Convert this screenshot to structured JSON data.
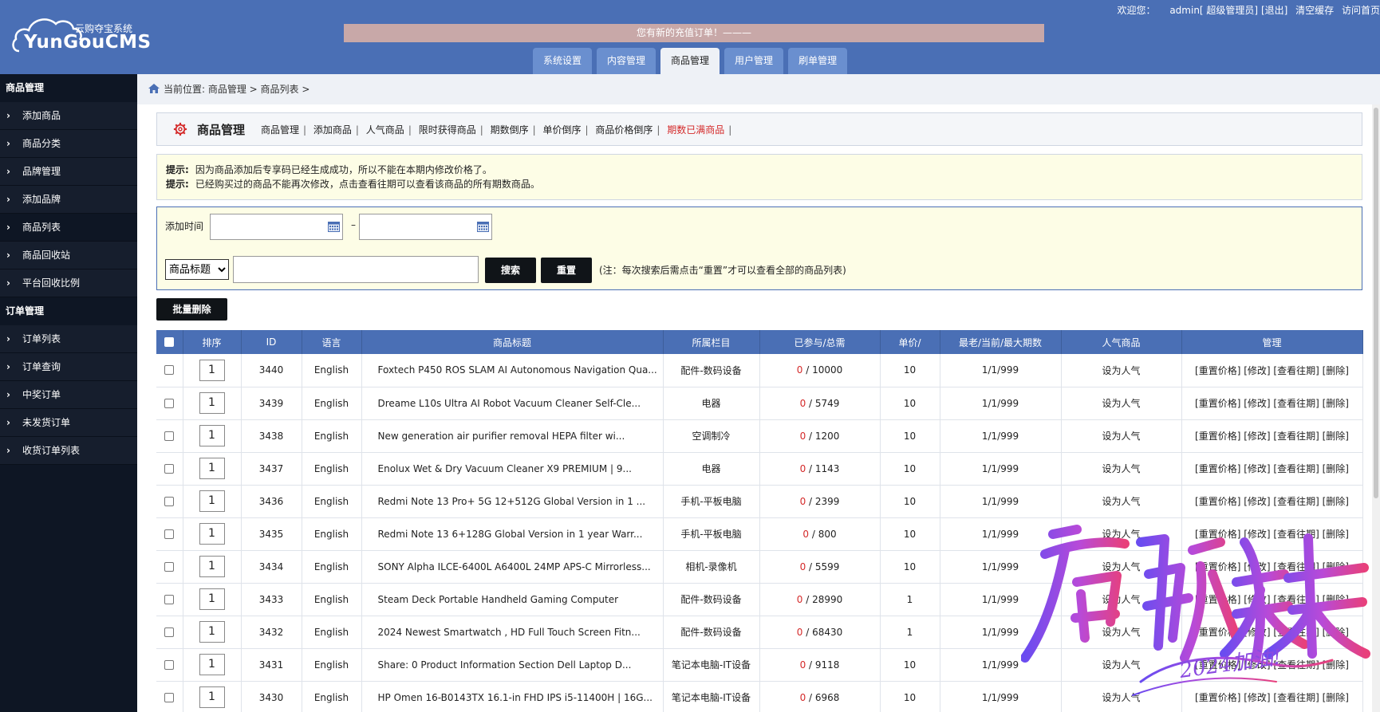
{
  "header": {
    "logo_sub": "云购夺宝系统",
    "logo_brand": "YunGouCMS",
    "notice": "您有新的充值订单！———",
    "welcome": "欢迎您：",
    "user": "admin[ 超级管理员]",
    "logout": "[退出]",
    "clear_cache": "清空缓存",
    "visit_home": "访问首页"
  },
  "tabs": [
    "系统设置",
    "内容管理",
    "商品管理",
    "用户管理",
    "刷单管理"
  ],
  "sidebar": {
    "groups": [
      {
        "title": "商品管理",
        "items": [
          "添加商品",
          "商品分类",
          "品牌管理",
          "添加品牌",
          "商品列表",
          "商品回收站",
          "平台回收比例"
        ]
      },
      {
        "title": "订单管理",
        "items": [
          "订单列表",
          "订单查询",
          "中奖订单",
          "未发货订单",
          "收货订单列表"
        ]
      }
    ]
  },
  "breadcrumb": "当前位置: 商品管理 > 商品列表 >",
  "panel": {
    "title": "商品管理",
    "links": [
      "商品管理",
      "添加商品",
      "人气商品",
      "限时获得商品",
      "期数倒序",
      "单价倒序",
      "商品价格倒序",
      "期数已满商品"
    ]
  },
  "tips": {
    "label": "提示:",
    "line1": "因为商品添加后专享码已经生成成功，所以不能在本期内修改价格了。",
    "line2": "已经购买过的商品不能再次修改，点击查看往期可以查看该商品的所有期数商品。"
  },
  "search": {
    "time_label": "添加时间",
    "dash": "–",
    "select_value": "商品标题",
    "search_btn": "搜索",
    "reset_btn": "重置",
    "note": "(注：每次搜索后需点击“重置”才可以查看全部的商品列表)"
  },
  "batch_delete": "批量删除",
  "table": {
    "headers": [
      "排序",
      "ID",
      "语言",
      "商品标题",
      "所属栏目",
      "已参与/总需",
      "单价/",
      "最老/当前/最大期数",
      "人气商品",
      "管理"
    ],
    "actions": "[重置价格] [修改] [查看往期] [删除]",
    "rows": [
      {
        "sort": "1",
        "id": "3440",
        "lang": "English",
        "title": "Foxtech P450 ROS SLAM AI Autonomous Navigation Qua...",
        "cat": "配件-数码设备",
        "joined": "0",
        "total": "/ 10000",
        "price": "10",
        "periods": "1/1/999",
        "hot": "设为人气"
      },
      {
        "sort": "1",
        "id": "3439",
        "lang": "English",
        "title": "Dreame L10s Ultra AI Robot Vacuum Cleaner Self-Cle...",
        "cat": "电器",
        "joined": "0",
        "total": "/ 5749",
        "price": "10",
        "periods": "1/1/999",
        "hot": "设为人气"
      },
      {
        "sort": "1",
        "id": "3438",
        "lang": "English",
        "title": "New generation air purifier removal HEPA filter wi...",
        "cat": "空调制冷",
        "joined": "0",
        "total": "/ 1200",
        "price": "10",
        "periods": "1/1/999",
        "hot": "设为人气"
      },
      {
        "sort": "1",
        "id": "3437",
        "lang": "English",
        "title": "Enolux Wet & Dry Vacuum Cleaner X9 PREMIUM | 9...",
        "cat": "电器",
        "joined": "0",
        "total": "/ 1143",
        "price": "10",
        "periods": "1/1/999",
        "hot": "设为人气"
      },
      {
        "sort": "1",
        "id": "3436",
        "lang": "English",
        "title": "Redmi Note 13 Pro+ 5G 12+512G Global Version in 1 ...",
        "cat": "手机-平板电脑",
        "joined": "0",
        "total": "/ 2399",
        "price": "10",
        "periods": "1/1/999",
        "hot": "设为人气"
      },
      {
        "sort": "1",
        "id": "3435",
        "lang": "English",
        "title": "Redmi Note 13 6+128G Global Version in 1 year Warr...",
        "cat": "手机-平板电脑",
        "joined": "0",
        "total": "/ 800",
        "price": "10",
        "periods": "1/1/999",
        "hot": "设为人气"
      },
      {
        "sort": "1",
        "id": "3434",
        "lang": "English",
        "title": "SONY Alpha ILCE-6400L A6400L 24MP APS-C Mirrorless...",
        "cat": "相机-录像机",
        "joined": "0",
        "total": "/ 5599",
        "price": "10",
        "periods": "1/1/999",
        "hot": "设为人气"
      },
      {
        "sort": "1",
        "id": "3433",
        "lang": "English",
        "title": "Steam Deck Portable Handheld Gaming Computer",
        "cat": "配件-数码设备",
        "joined": "0",
        "total": "/ 28990",
        "price": "1",
        "periods": "1/1/999",
        "hot": "设为人气"
      },
      {
        "sort": "1",
        "id": "3432",
        "lang": "English",
        "title": "2024 Newest Smartwatch , HD Full Touch Screen Fitn...",
        "cat": "配件-数码设备",
        "joined": "0",
        "total": "/ 68430",
        "price": "1",
        "periods": "1/1/999",
        "hot": "设为人气"
      },
      {
        "sort": "1",
        "id": "3431",
        "lang": "English",
        "title": "Share: 0 Product Information Section Dell Laptop D...",
        "cat": "笔记本电脑-IT设备",
        "joined": "0",
        "total": "/ 9118",
        "price": "10",
        "periods": "1/1/999",
        "hot": "设为人气"
      },
      {
        "sort": "1",
        "id": "3430",
        "lang": "English",
        "title": "HP Omen 16-B0143TX 16.1-in FHD IPS i5-11400H | 16G...",
        "cat": "笔记本电脑-IT设备",
        "joined": "0",
        "total": "/ 6968",
        "price": "10",
        "periods": "1/1/999",
        "hot": "设为人气"
      }
    ]
  },
  "watermark": {
    "main": "启航未来",
    "sub": "2024加油!"
  },
  "colors": {
    "header_blue": "#4a6fb5",
    "sidebar_dark": "#0e1624",
    "tip_bg": "#fdfde6",
    "red": "#d42a2a"
  }
}
